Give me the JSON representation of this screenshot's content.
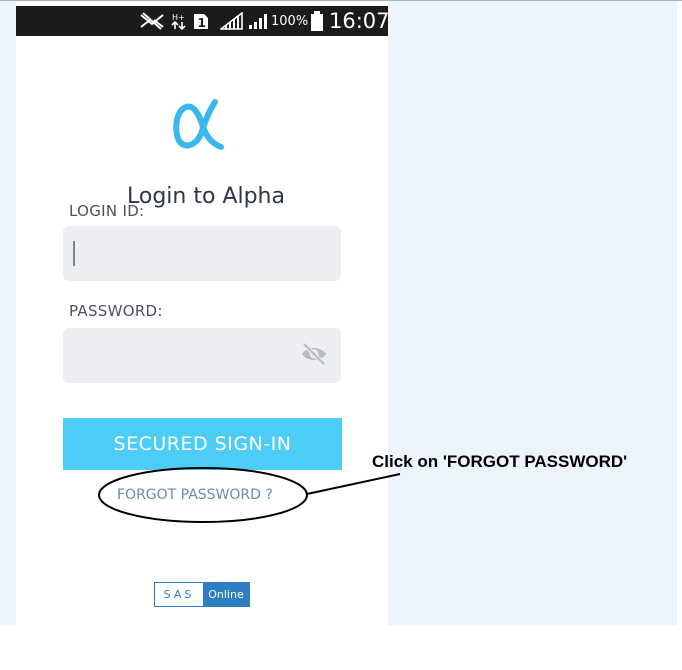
{
  "status_bar": {
    "icons": [
      "silent-mode-icon",
      "data-arrows-icon",
      "sim-1-icon",
      "signal-1-icon",
      "signal-2-icon",
      "battery-icon"
    ],
    "battery_percent": "100%",
    "time": "16:07"
  },
  "app": {
    "logo_icon": "alpha-logo-icon",
    "title": "Login to Alpha",
    "login_id": {
      "label": "LOGIN ID:",
      "value": ""
    },
    "password": {
      "label": "PASSWORD:",
      "value": "",
      "toggle_icon": "eye-slash-icon"
    },
    "sign_in_label": "SECURED SIGN-IN",
    "forgot_password_label": "FORGOT PASSWORD ?",
    "footer_logo": {
      "part1": "SAS",
      "part2": "Online"
    }
  },
  "annotation": {
    "text": "Click on 'FORGOT PASSWORD'"
  },
  "colors": {
    "accent": "#4dcdf6",
    "logo": "#39b8ef",
    "field_bg": "#eceef2",
    "link": "#6d8aa9",
    "footer_blue": "#2f7ec1"
  }
}
